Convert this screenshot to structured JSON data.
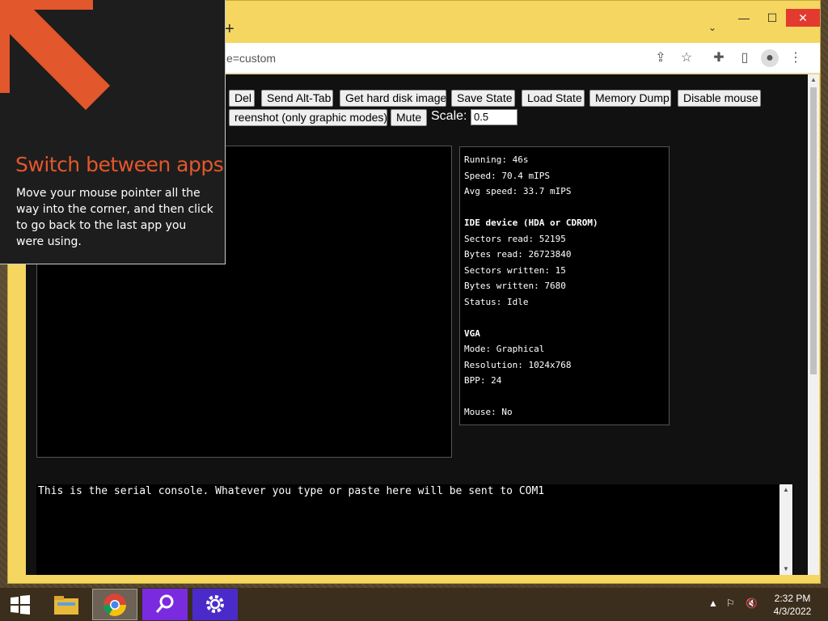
{
  "browser": {
    "new_tab": "+",
    "tab_dropdown": "⌄",
    "window_controls": {
      "minimize": "—",
      "maximize": "☐",
      "close": "✕"
    },
    "address": "e=custom",
    "icons": [
      "share-icon",
      "star-icon",
      "extensions-icon",
      "sidepanel-icon",
      "profile-icon",
      "menu-icon"
    ]
  },
  "emulator": {
    "buttons_row1": [
      "Del",
      "Send Alt-Tab",
      "Get hard disk image",
      "Save State",
      "Load State",
      "Memory Dump",
      "Disable mouse"
    ],
    "screenshot_label": "reenshot (only graphic modes)",
    "mute_label": "Mute",
    "scale_label": "Scale:",
    "scale_value": "0.5",
    "stats": {
      "running": "Running: 46s",
      "speed": "Speed: 70.4 mIPS",
      "avg_speed": "Avg speed: 33.7 mIPS",
      "ide_header": "IDE device (HDA or CDROM)",
      "sectors_read": "Sectors read: 52195",
      "bytes_read": "Bytes read: 26723840",
      "sectors_written": "Sectors written: 15",
      "bytes_written": "Bytes written: 7680",
      "status": "Status: Idle",
      "vga_header": "VGA",
      "mode": "Mode: Graphical",
      "resolution": "Resolution: 1024x768",
      "bpp": "BPP: 24",
      "mouse": "Mouse: No"
    },
    "serial_console": "This is the serial console. Whatever you type or paste here will be sent to COM1"
  },
  "hint": {
    "title": "Switch between apps",
    "body": "Move your mouse pointer all the way into the corner, and then click to go back to the last app you were using."
  },
  "taskbar": {
    "apps": [
      "file-explorer",
      "chrome",
      "search-app",
      "settings-app"
    ],
    "time": "2:32 PM",
    "date": "4/3/2022"
  },
  "colors": {
    "accent_orange": "#e2572b",
    "chrome_frame": "#f4d661"
  }
}
